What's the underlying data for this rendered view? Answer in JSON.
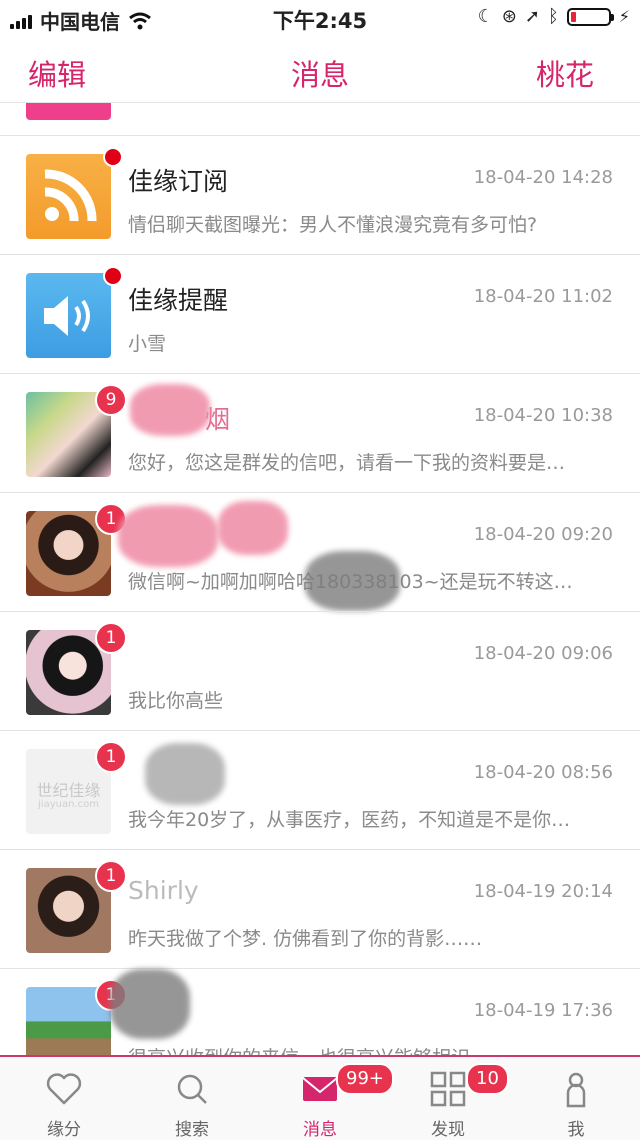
{
  "status_bar": {
    "carrier": "中国电信",
    "time": "下午2:45"
  },
  "nav": {
    "left": "编辑",
    "title": "消息",
    "right": "桃花"
  },
  "conversations": [
    {
      "name": "佳缘订阅",
      "time": "18-04-20 14:28",
      "preview": "情侣聊天截图曝光：男人不懂浪漫究竟有多可怕?",
      "unread_dot": true
    },
    {
      "name": "佳缘提醒",
      "time": "18-04-20 11:02",
      "preview": "小雪",
      "unread_dot": true
    },
    {
      "name": "烟",
      "time": "18-04-20 10:38",
      "preview": "您好，您这是群发的信吧，请看一下我的资料要是…",
      "badge": "9"
    },
    {
      "name": "",
      "time": "18-04-20 09:20",
      "preview": "微信啊~加啊加啊哈哈180338103~还是玩不转这…",
      "badge": "1"
    },
    {
      "name": "",
      "time": "18-04-20 09:06",
      "preview": "我比你高些",
      "badge": "1"
    },
    {
      "name": "",
      "time": "18-04-20 08:56",
      "preview": "我今年20岁了，从事医疗，医药，不知道是不是你…",
      "badge": "1",
      "avatar_watermark": "世纪佳缘",
      "avatar_watermark_sub": "jiayuan.com"
    },
    {
      "name": "Shirly",
      "time": "18-04-19 20:14",
      "preview": "昨天我做了个梦. 仿佛看到了你的背影……",
      "badge": "1"
    },
    {
      "name": "",
      "time": "18-04-19 17:36",
      "preview": "很高兴收到你的来信，也很高兴能够相识",
      "badge": "1"
    }
  ],
  "tabs": [
    {
      "label": "缘分"
    },
    {
      "label": "搜索"
    },
    {
      "label": "消息",
      "badge": "99+"
    },
    {
      "label": "发现",
      "badge": "10"
    },
    {
      "label": "我"
    }
  ],
  "colors": {
    "accent": "#d6266b",
    "badge": "#e8334f"
  }
}
